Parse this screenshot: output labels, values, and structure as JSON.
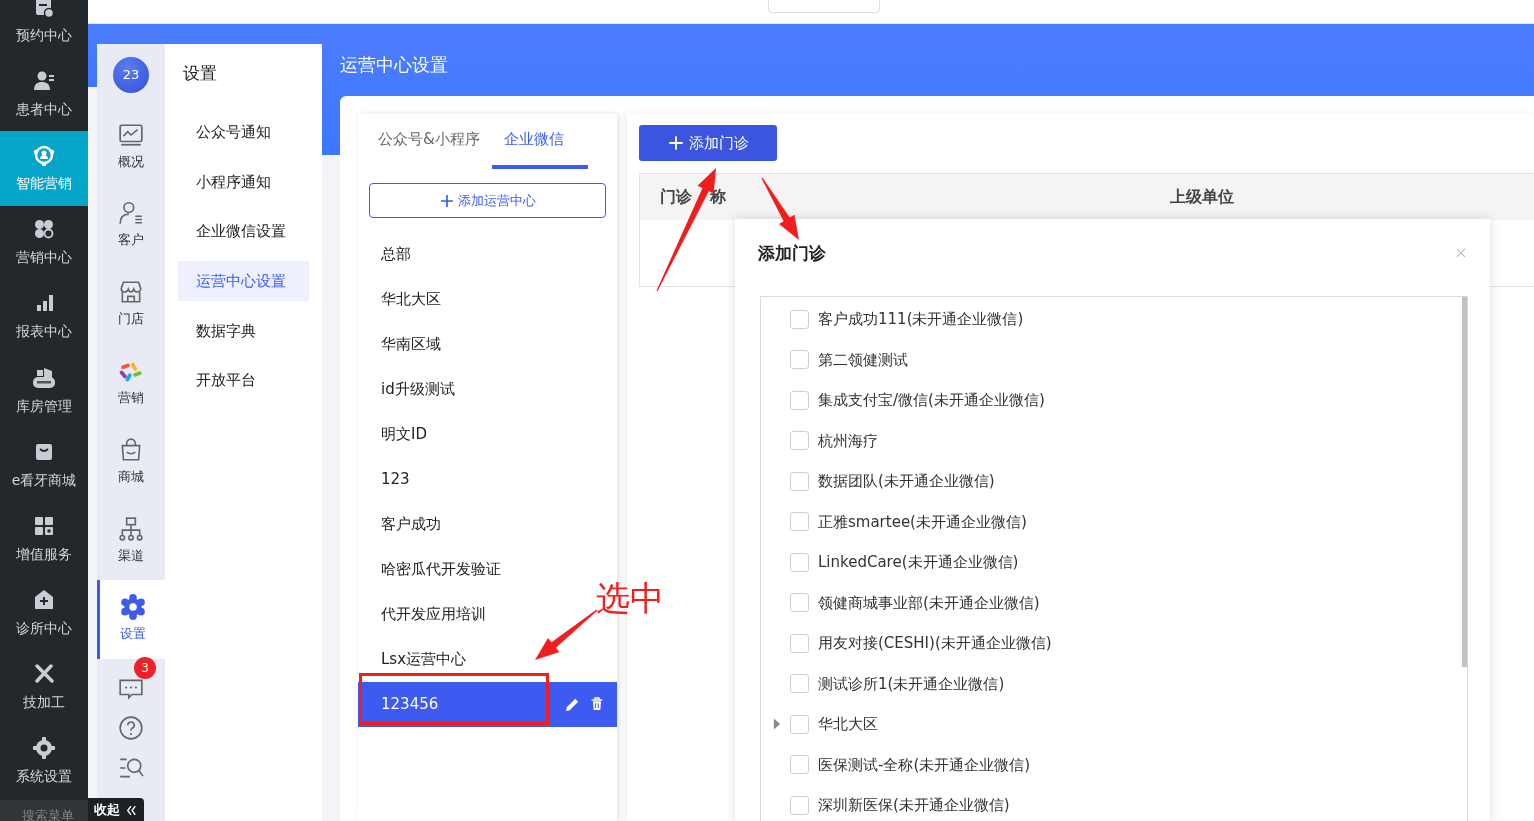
{
  "nav": {
    "items": [
      {
        "label": "预约中心",
        "selected": false
      },
      {
        "label": "患者中心",
        "selected": false
      },
      {
        "label": "智能营销",
        "selected": true
      },
      {
        "label": "营销中心",
        "selected": false
      },
      {
        "label": "报表中心",
        "selected": false
      },
      {
        "label": "库房管理",
        "selected": false
      },
      {
        "label": "e看牙商城",
        "selected": false
      },
      {
        "label": "增值服务",
        "selected": false
      },
      {
        "label": "诊所中心",
        "selected": false
      },
      {
        "label": "技加工",
        "selected": false
      },
      {
        "label": "系统设置",
        "selected": false
      }
    ],
    "search_placeholder": "搜索菜单",
    "collapse": "收起"
  },
  "icon_bar": {
    "avatar": "23",
    "items": [
      {
        "label": "概况",
        "selected": false
      },
      {
        "label": "客户",
        "selected": false
      },
      {
        "label": "门店",
        "selected": false
      },
      {
        "label": "营销",
        "selected": false
      },
      {
        "label": "商城",
        "selected": false
      },
      {
        "label": "渠道",
        "selected": false
      },
      {
        "label": "设置",
        "selected": true
      }
    ],
    "message_badge": "3"
  },
  "settings_menu": {
    "title": "设置",
    "items": [
      {
        "label": "公众号通知",
        "selected": false
      },
      {
        "label": "小程序通知",
        "selected": false
      },
      {
        "label": "企业微信设置",
        "selected": false
      },
      {
        "label": "运营中心设置",
        "selected": true
      },
      {
        "label": "数据字典",
        "selected": false
      },
      {
        "label": "开放平台",
        "selected": false
      }
    ]
  },
  "page_title": "运营中心设置",
  "tabs": [
    {
      "label": "公众号&小程序",
      "selected": false
    },
    {
      "label": "企业微信",
      "selected": true
    }
  ],
  "add_center_button": "添加运营中心",
  "centers": [
    {
      "name": "总部",
      "selected": false
    },
    {
      "name": "华北大区",
      "selected": false
    },
    {
      "name": "华南区域",
      "selected": false
    },
    {
      "name": "id升级测试",
      "selected": false
    },
    {
      "name": "明文ID",
      "selected": false
    },
    {
      "name": "123",
      "selected": false
    },
    {
      "name": "客户成功",
      "selected": false
    },
    {
      "name": "哈密瓜代开发验证",
      "selected": false
    },
    {
      "name": "代开发应用培训",
      "selected": false
    },
    {
      "name": "Lsx运营中心",
      "selected": false
    },
    {
      "name": "123456",
      "selected": true
    }
  ],
  "add_clinic_button": "添加门诊",
  "table": {
    "columns": [
      {
        "text_parts": [
          "门诊",
          "称"
        ]
      },
      {
        "text_parts": [
          "上级单位"
        ]
      }
    ]
  },
  "dialog": {
    "title": "添加门诊",
    "clinics": [
      {
        "name": "客户成功111(未开通企业微信)",
        "checked": false,
        "expandable": false
      },
      {
        "name": "第二领健测试",
        "checked": false,
        "expandable": false
      },
      {
        "name": "集成支付宝/微信(未开通企业微信)",
        "checked": false,
        "expandable": false
      },
      {
        "name": "杭州海疗",
        "checked": false,
        "expandable": false
      },
      {
        "name": "数据团队(未开通企业微信)",
        "checked": false,
        "expandable": false
      },
      {
        "name": "正雅smartee(未开通企业微信)",
        "checked": false,
        "expandable": false
      },
      {
        "name": "LinkedCare(未开通企业微信)",
        "checked": false,
        "expandable": false
      },
      {
        "name": "领健商城事业部(未开通企业微信)",
        "checked": false,
        "expandable": false
      },
      {
        "name": "用友对接(CESHI)(未开通企业微信)",
        "checked": false,
        "expandable": false
      },
      {
        "name": "测试诊所1(未开通企业微信)",
        "checked": false,
        "expandable": false
      },
      {
        "name": "华北大区",
        "checked": false,
        "expandable": true
      },
      {
        "name": "医保测试-全称(未开通企业微信)",
        "checked": false,
        "expandable": false
      },
      {
        "name": "深圳新医保(未开通企业微信)",
        "checked": false,
        "expandable": false
      }
    ]
  },
  "annotation": {
    "text": "选中"
  }
}
